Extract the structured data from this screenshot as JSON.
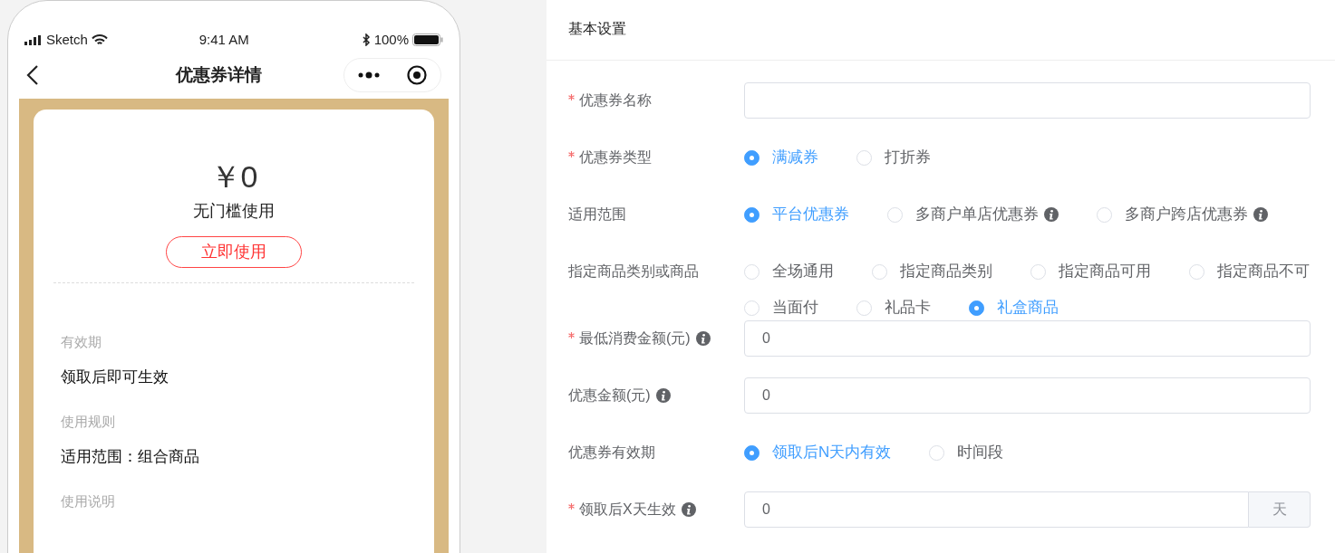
{
  "phone": {
    "status_bar": {
      "carrier": "Sketch",
      "time": "9:41 AM",
      "battery": "100%"
    },
    "nav": {
      "title": "优惠券详情"
    },
    "coupon": {
      "amount": "￥0",
      "condition": "无门槛使用",
      "use_button": "立即使用",
      "sections": [
        {
          "label": "有效期",
          "value": "领取后即可生效"
        },
        {
          "label": "使用规则",
          "value": "适用范围：组合商品"
        },
        {
          "label": "使用说明"
        }
      ]
    }
  },
  "form": {
    "title": "基本设置",
    "fields": [
      {
        "kind": "input",
        "label": "优惠券名称",
        "required": true,
        "info": false
      },
      {
        "kind": "radio",
        "label": "优惠券类型",
        "required": true,
        "info": false,
        "options": [
          {
            "label": "满减券",
            "selected": true,
            "info": false
          },
          {
            "label": "打折券",
            "selected": false,
            "info": false
          }
        ]
      },
      {
        "kind": "radio",
        "label": "适用范围",
        "required": false,
        "info": false,
        "options": [
          {
            "label": "平台优惠券",
            "selected": true,
            "info": false
          },
          {
            "label": "多商户单店优惠券",
            "selected": false,
            "info": true
          },
          {
            "label": "多商户跨店优惠券",
            "selected": false,
            "info": true
          }
        ]
      },
      {
        "kind": "radio",
        "label": "指定商品类别或商品",
        "required": false,
        "info": false,
        "options": [
          {
            "label": "全场通用",
            "selected": false,
            "info": false
          },
          {
            "label": "指定商品类别",
            "selected": false,
            "info": false
          },
          {
            "label": "指定商品可用",
            "selected": false,
            "info": false
          },
          {
            "label": "指定商品不可",
            "selected": false,
            "info": false
          },
          {
            "label": "当面付",
            "selected": false,
            "info": false
          },
          {
            "label": "礼品卡",
            "selected": false,
            "info": false
          },
          {
            "label": "礼盒商品",
            "selected": true,
            "info": false
          }
        ]
      },
      {
        "kind": "input",
        "label": "最低消费金额(元)",
        "required": true,
        "info": true,
        "value": "0"
      },
      {
        "kind": "input",
        "label": "优惠金额(元)",
        "required": false,
        "info": true,
        "value": "0"
      },
      {
        "kind": "radio",
        "label": "优惠券有效期",
        "required": false,
        "info": false,
        "options": [
          {
            "label": "领取后N天内有效",
            "selected": true,
            "info": false
          },
          {
            "label": "时间段",
            "selected": false,
            "info": false
          }
        ]
      },
      {
        "kind": "addon_input",
        "label": "领取后X天生效",
        "required": true,
        "info": true,
        "value": "0",
        "addon": "天"
      }
    ]
  }
}
